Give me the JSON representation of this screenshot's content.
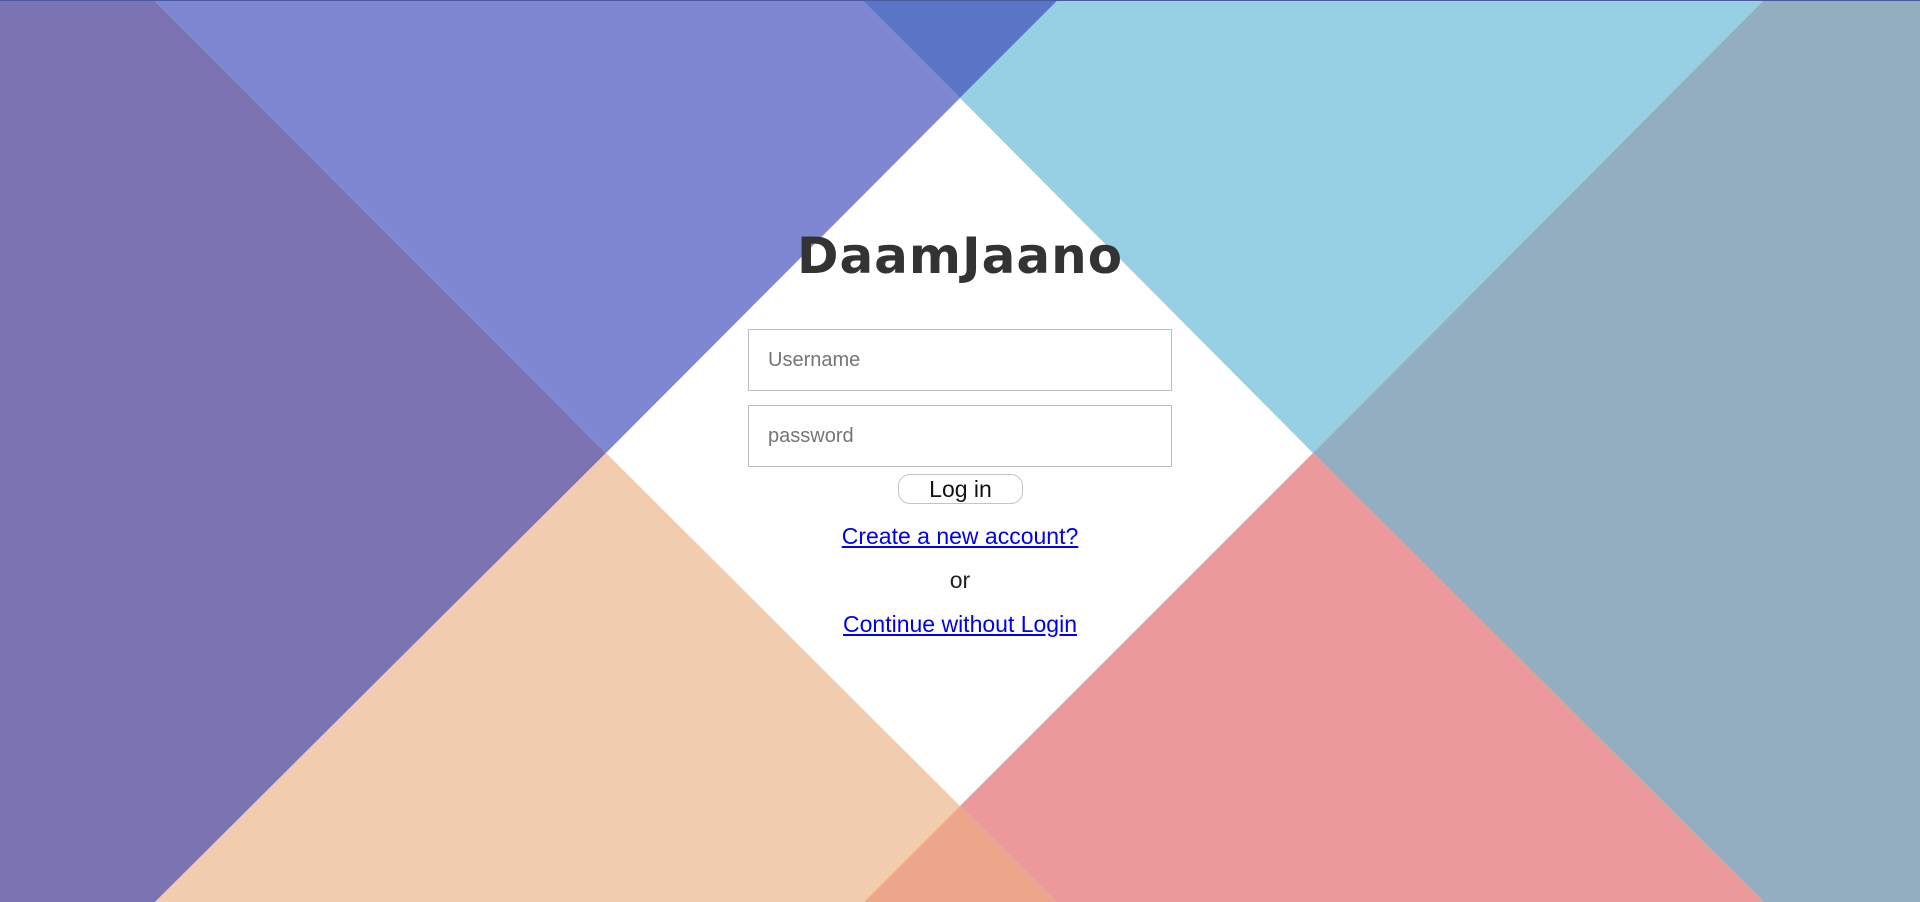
{
  "app": {
    "title": "DaamJaano"
  },
  "form": {
    "username_placeholder": "Username",
    "username_value": "",
    "password_placeholder": "password",
    "password_value": "",
    "login_label": "Log in"
  },
  "links": {
    "create_account": "Create a new account?",
    "separator": "or",
    "continue_without_login": "Continue without Login"
  },
  "colors": {
    "top_left": "#7b73b2",
    "top_left_inner": "#7f87d2",
    "top_center": "#5b76c7",
    "top_right_inner": "#98d0e3",
    "top_right": "#92aec0",
    "bottom_left_inner": "#f2ccaf",
    "bottom_center": "#eca689",
    "bottom_right_inner": "#ec999c",
    "link": "#0000ee"
  }
}
